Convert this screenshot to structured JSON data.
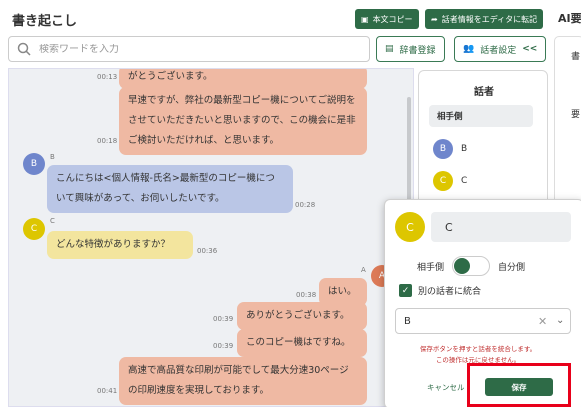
{
  "header": {
    "title": "書き起こし",
    "copy_label": "本文コピー",
    "transfer_label": "話者情報をエディタに転記",
    "ai_title": "AI要"
  },
  "toolbar": {
    "search_placeholder": "検索ワードを入力",
    "dict_label": "辞書登録",
    "speaker_settings_label": "話者設定",
    "collapse_label": "<<"
  },
  "chat": {
    "messages": [
      {
        "speaker": "A",
        "text": "がとうございます。",
        "time": "00:13"
      },
      {
        "speaker": "A",
        "text": "早速ですが、弊社の最新型コピー機についてご説明をさせていただきたいと思いますので、この機会に是非ご検討いただければ、と思います。",
        "time": "00:18"
      },
      {
        "speaker": "B",
        "text": "こんにちは<個人情報-氏名>最新型のコピー機について興味があって、お伺いしたいです。",
        "time": "00:28"
      },
      {
        "speaker": "C",
        "text": "どんな特徴がありますか？",
        "time": "00:36"
      },
      {
        "speaker": "A",
        "text": "はい。",
        "time": "00:38"
      },
      {
        "speaker": "A",
        "text": "ありがとうございます。",
        "time": "00:39"
      },
      {
        "speaker": "A",
        "text": "このコピー機はですね。",
        "time": "00:39"
      },
      {
        "speaker": "A",
        "text": "高速で高品質な印刷が可能でして最大分速30ページの印刷速度を実現しております。",
        "time": "00:41"
      }
    ]
  },
  "speakers_panel": {
    "title": "話者",
    "group_label": "相手側",
    "items": [
      {
        "id": "B",
        "label": "B",
        "color": "#6f86cc"
      },
      {
        "id": "C",
        "label": "C",
        "color": "#ddc600"
      }
    ]
  },
  "right_panel": {
    "label1": "書",
    "label2": "要"
  },
  "popup": {
    "avatar_label": "C",
    "name_value": "C",
    "toggle_left": "相手側",
    "toggle_right": "自分側",
    "merge_label": "別の話者に統合",
    "merge_target": "B",
    "warning_line1": "保存ボタンを押すと話者を統合します。",
    "warning_line2": "この操作は元に戻せません。",
    "cancel_label": "キャンセル",
    "save_label": "保存"
  },
  "colors": {
    "brand": "#2e6b47",
    "speaker_a": "#efb9a3",
    "speaker_b": "#bac6e6",
    "speaker_c": "#f3e59e",
    "highlight": "#e8001a"
  }
}
